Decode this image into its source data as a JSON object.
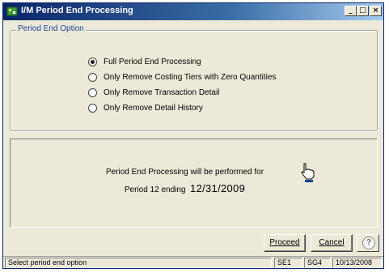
{
  "window": {
    "title": "I/M Period End Processing",
    "controls": {
      "minimize": "_",
      "maximize": "□",
      "close": "×"
    }
  },
  "options": {
    "legend": "Period End Option",
    "radios": [
      {
        "label": "Full Period End Processing",
        "selected": true
      },
      {
        "label": "Only Remove Costing Tiers with Zero Quantities",
        "selected": false
      },
      {
        "label": "Only Remove Transaction Detail",
        "selected": false
      },
      {
        "label": "Only Remove Detail History",
        "selected": false
      }
    ]
  },
  "info": {
    "line1": "Period End Processing will be performed for",
    "line2_prefix": "Period 12 ending",
    "line2_date": "12/31/2009"
  },
  "buttons": {
    "proceed": "Proceed",
    "cancel": "Cancel",
    "help": "?"
  },
  "statusbar": {
    "message": "Select period end option",
    "company": "SE1",
    "user": "SG4",
    "date": "10/13/2008"
  },
  "colors": {
    "title_start": "#0a246a",
    "title_end": "#a6caf0",
    "dialog_bg": "#ece9d8",
    "legend_text": "#1c3f9e"
  }
}
